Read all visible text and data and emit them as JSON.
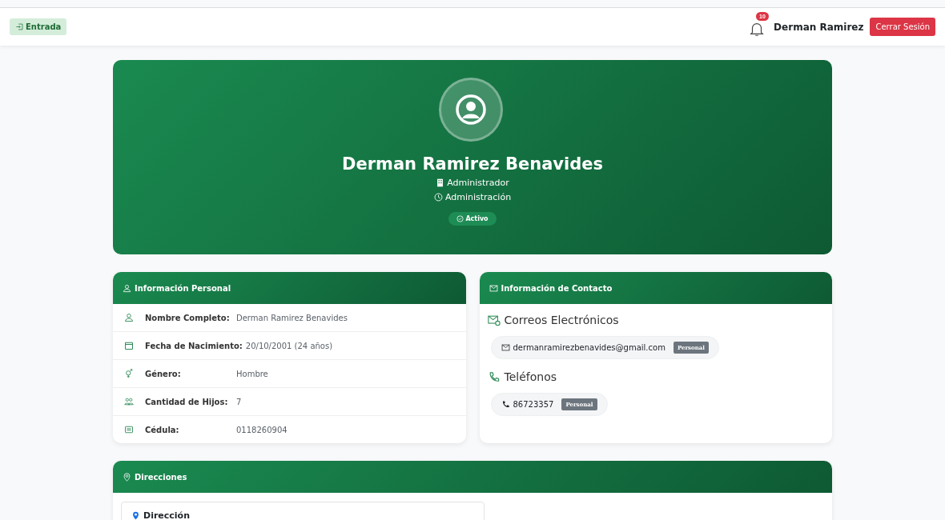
{
  "topbar": {
    "entry_button": "Entrada",
    "notification_count": "10",
    "user_name": "Derman Ramirez",
    "logout_button": "Cerrar Sesión"
  },
  "profile": {
    "name": "Derman Ramirez Benavides",
    "role": "Administrador",
    "department": "Administración",
    "status": "Activo"
  },
  "personal_info": {
    "title": "Información Personal",
    "rows": [
      {
        "label": "Nombre Completo:",
        "value": "Derman Ramirez Benavides"
      },
      {
        "label": "Fecha de Nacimiento:",
        "value": "20/10/2001 (24 años)"
      },
      {
        "label": "Género:",
        "value": "Hombre"
      },
      {
        "label": "Cantidad de Hijos:",
        "value": "7"
      },
      {
        "label": "Cédula:",
        "value": "0118260904"
      }
    ]
  },
  "contact_info": {
    "title": "Información de Contacto",
    "emails_title": "Correos Electrónicos",
    "emails": [
      {
        "value": "dermanramirezbenavides@gmail.com",
        "tag": "Personal"
      }
    ],
    "phones_title": "Teléfonos",
    "phones": [
      {
        "value": "86723357",
        "tag": "Personal"
      }
    ]
  },
  "addresses": {
    "title": "Direcciones",
    "items": [
      {
        "title": "Dirección"
      }
    ]
  }
}
